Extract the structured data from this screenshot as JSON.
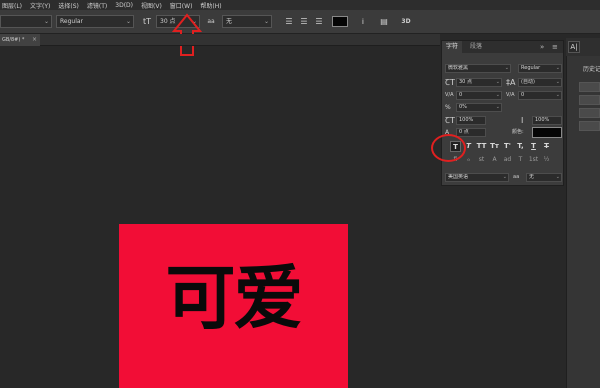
{
  "menu": [
    "图层(L)",
    "文字(Y)",
    "选择(S)",
    "滤镜(T)",
    "3D(D)",
    "视图(V)",
    "窗口(W)",
    "帮助(H)"
  ],
  "options_bar": {
    "font_family": "",
    "font_style": "Regular",
    "font_size_icon": "tT",
    "font_size": "30 点",
    "aa_icon": "aa",
    "aa_mode": "无",
    "text_color": "#050505",
    "threed_label": "3D"
  },
  "document_tab": {
    "label": "GB/8#) *",
    "close": "×"
  },
  "canvas": {
    "background_color": "#f20d36",
    "text": "可爱",
    "text_color": "#0a0a0a"
  },
  "character_panel": {
    "tabs": [
      "字符",
      "段落"
    ],
    "collapse": "»",
    "menu": "≡",
    "font_family": "微软雅黑",
    "font_style": "Regular",
    "font_size": "30 点",
    "leading": "(自动)",
    "kerning_label": "V/A",
    "kerning": "0",
    "tracking_label": "V/A",
    "tracking": "0",
    "scale_label": "%",
    "scale": "0%",
    "vertical_scale": "100%",
    "horizontal_scale": "100%",
    "baseline_label": "A",
    "baseline_shift": "0 点",
    "color_label": "颜色:",
    "color_swatch": "#050505",
    "style_buttons": [
      "T",
      "T",
      "TT",
      "Tт",
      "T'",
      "T,",
      "T",
      "T"
    ],
    "opentype_buttons": [
      "fi",
      "ℴ",
      "st",
      "A",
      "ad",
      "T",
      "1st",
      "½"
    ],
    "language": "美国英语",
    "aa_label": "aa",
    "aa_mode": "无"
  },
  "right_dock": {
    "history_label": "历史记",
    "ai_label": "A|"
  }
}
